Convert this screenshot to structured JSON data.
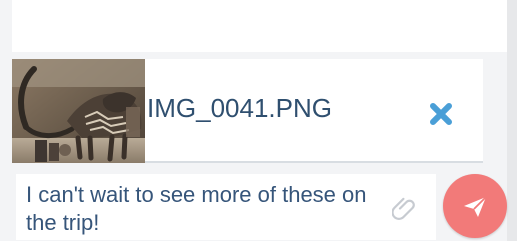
{
  "attachment": {
    "filename": "IMG_0041.PNG",
    "image_alt": "mammoth skeleton",
    "remove_icon": "close-icon"
  },
  "composer": {
    "message": "I can't wait to see more of these on the trip!",
    "attach_icon": "paperclip-icon",
    "send_icon": "send-icon"
  },
  "colors": {
    "filename_text": "#2f4f6f",
    "message_text": "#36557a",
    "close_icon": "#4a9fd7",
    "send_button": "#f27a79",
    "paperclip_icon": "#c7cbd1",
    "background": "#f3f4f6"
  }
}
